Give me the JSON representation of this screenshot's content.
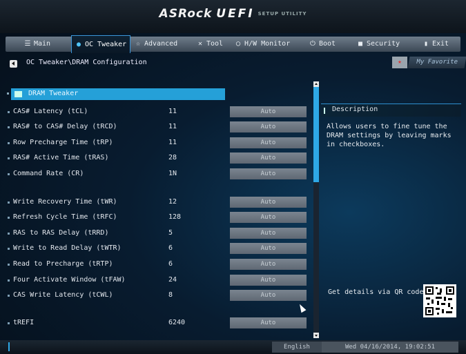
{
  "header": {
    "brand": "ASRock",
    "product": "UEFI",
    "subtitle": "SETUP UTILITY"
  },
  "tabs": [
    {
      "label": "Main",
      "icon": "list-icon"
    },
    {
      "label": "OC Tweaker",
      "icon": "flame-icon",
      "active": true
    },
    {
      "label": "Advanced",
      "icon": "star-icon"
    },
    {
      "label": "Tool",
      "icon": "tools-icon"
    },
    {
      "label": "H/W Monitor",
      "icon": "monitor-icon"
    },
    {
      "label": "Boot",
      "icon": "power-icon"
    },
    {
      "label": "Security",
      "icon": "shield-icon"
    },
    {
      "label": "Exit",
      "icon": "exit-icon"
    }
  ],
  "breadcrumb": "OC Tweaker\\DRAM Configuration",
  "my_favorite": "My Favorite",
  "section": {
    "label": "DRAM Tweaker"
  },
  "settings": [
    {
      "label": "CAS# Latency (tCL)",
      "value": "11",
      "option": "Auto"
    },
    {
      "label": "RAS# to CAS# Delay (tRCD)",
      "value": "11",
      "option": "Auto"
    },
    {
      "label": "Row Precharge Time (tRP)",
      "value": "11",
      "option": "Auto"
    },
    {
      "label": "RAS# Active Time (tRAS)",
      "value": "28",
      "option": "Auto"
    },
    {
      "label": "Command Rate (CR)",
      "value": "1N",
      "option": "Auto"
    },
    {
      "label": "Write Recovery Time (tWR)",
      "value": "12",
      "option": "Auto"
    },
    {
      "label": "Refresh Cycle Time (tRFC)",
      "value": "128",
      "option": "Auto"
    },
    {
      "label": "RAS to RAS Delay (tRRD)",
      "value": "5",
      "option": "Auto"
    },
    {
      "label": "Write to Read Delay (tWTR)",
      "value": "6",
      "option": "Auto"
    },
    {
      "label": "Read to Precharge (tRTP)",
      "value": "6",
      "option": "Auto"
    },
    {
      "label": "Four Activate Window (tFAW)",
      "value": "24",
      "option": "Auto"
    },
    {
      "label": "CAS Write Latency (tCWL)",
      "value": "8",
      "option": "Auto"
    },
    {
      "label": "tREFI",
      "value": "6240",
      "option": "Auto"
    }
  ],
  "description": {
    "title": "Description",
    "text": "Allows users to fine tune the DRAM settings by leaving marks in checkboxes.",
    "qr_label": "Get details via QR code"
  },
  "footer": {
    "language": "English",
    "datetime": "Wed 04/16/2014, 19:02:51"
  },
  "colors": {
    "accent": "#25a0d8",
    "option_bg": "#6d7680",
    "background": "#081c30"
  }
}
